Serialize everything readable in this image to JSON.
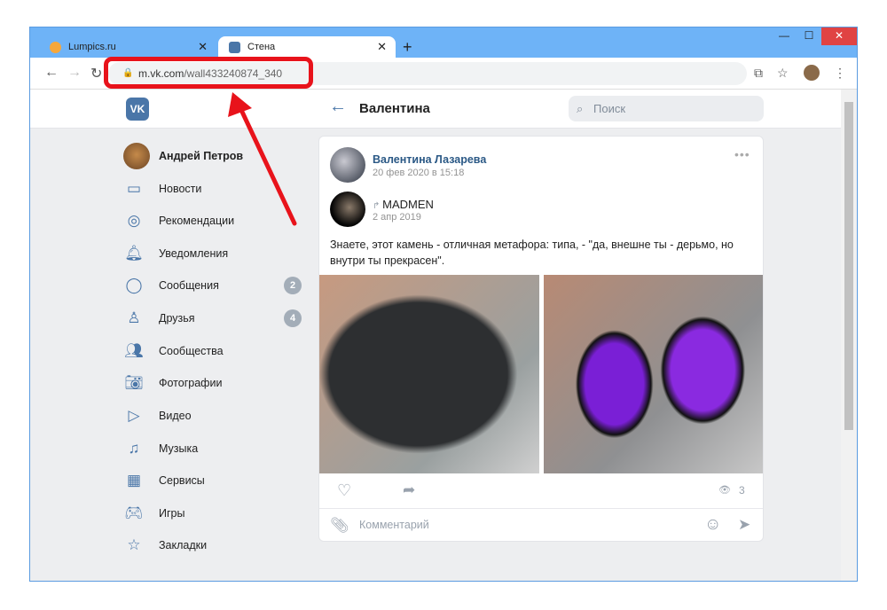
{
  "browser": {
    "tabs": [
      {
        "label": "Lumpics.ru",
        "icon": "lumpics-favicon"
      },
      {
        "label": "Стена",
        "icon": "vk-favicon",
        "active": true
      }
    ],
    "url_host": "m.vk.com",
    "url_path": "/wall433240874_340"
  },
  "vk": {
    "logo": "VK",
    "page_title": "Валентина",
    "search_placeholder": "Поиск",
    "profile_name": "Андрей Петров",
    "menu": [
      {
        "label": "Новости",
        "icon": "news-icon"
      },
      {
        "label": "Рекомендации",
        "icon": "compass-icon"
      },
      {
        "label": "Уведомления",
        "icon": "bell-icon"
      },
      {
        "label": "Сообщения",
        "icon": "message-icon",
        "badge": "2"
      },
      {
        "label": "Друзья",
        "icon": "user-icon",
        "badge": "4"
      },
      {
        "label": "Сообщества",
        "icon": "group-icon"
      },
      {
        "label": "Фотографии",
        "icon": "camera-icon"
      },
      {
        "label": "Видео",
        "icon": "video-icon"
      },
      {
        "label": "Музыка",
        "icon": "music-icon"
      },
      {
        "label": "Сервисы",
        "icon": "services-icon"
      },
      {
        "label": "Игры",
        "icon": "gamepad-icon"
      },
      {
        "label": "Закладки",
        "icon": "star-icon"
      }
    ],
    "post": {
      "author": "Валентина Лазарева",
      "date": "20 фев 2020 в 15:18",
      "repost_source": "MADMEN",
      "repost_date": "2 апр 2019",
      "text": "Знаете, этот камень - отличная метафора: типа, - \"да, внешне ты - дерьмо, но внутри ты прекрасен\".",
      "views": "3",
      "comment_placeholder": "Комментарий"
    }
  }
}
